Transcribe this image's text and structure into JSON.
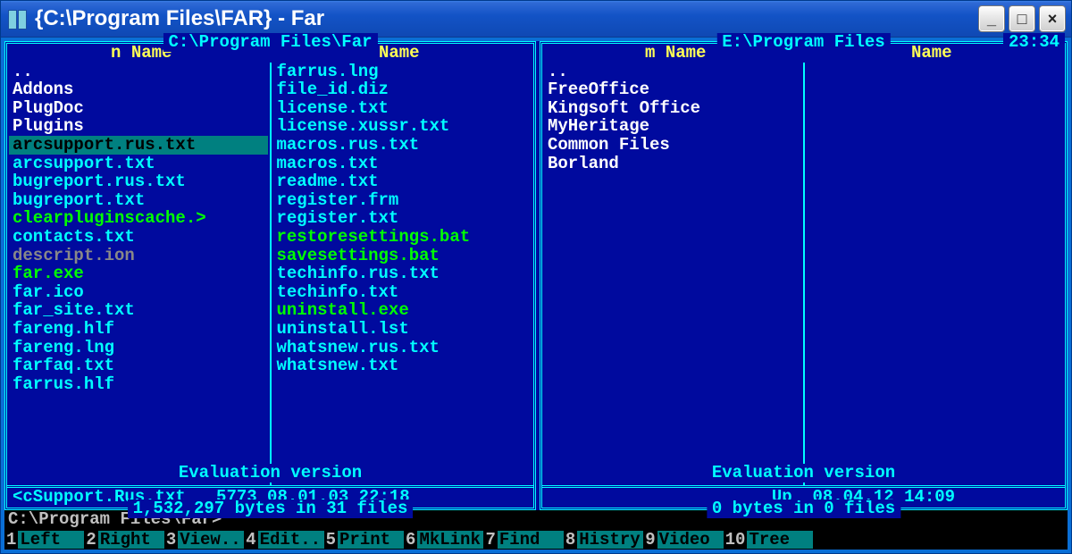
{
  "window": {
    "title": "{C:\\Program Files\\FAR} - Far",
    "buttons": {
      "min": "_",
      "max": "□",
      "close": "×"
    }
  },
  "clock": "23:34",
  "panels": {
    "left": {
      "path": " C:\\Program Files\\Far ",
      "col_heads": [
        "n       Name",
        "Name"
      ],
      "cols": [
        [
          {
            "text": "..",
            "cls": "clr-white"
          },
          {
            "text": "Addons",
            "cls": "clr-white"
          },
          {
            "text": "PlugDoc",
            "cls": "clr-white"
          },
          {
            "text": "Plugins",
            "cls": "clr-white"
          },
          {
            "text": "arcsupport.rus.txt",
            "cls": "sel"
          },
          {
            "text": "arcsupport.txt",
            "cls": "clr-cyan"
          },
          {
            "text": "bugreport.rus.txt",
            "cls": "clr-cyan"
          },
          {
            "text": "bugreport.txt",
            "cls": "clr-cyan"
          },
          {
            "text": "clearpluginscache.>",
            "cls": "clr-green"
          },
          {
            "text": "contacts.txt",
            "cls": "clr-cyan"
          },
          {
            "text": "descript.ion",
            "cls": "clr-gray"
          },
          {
            "text": "far.exe",
            "cls": "clr-green"
          },
          {
            "text": "far.ico",
            "cls": "clr-cyan"
          },
          {
            "text": "far_site.txt",
            "cls": "clr-cyan"
          },
          {
            "text": "fareng.hlf",
            "cls": "clr-cyan"
          },
          {
            "text": "fareng.lng",
            "cls": "clr-cyan"
          },
          {
            "text": "farfaq.txt",
            "cls": "clr-cyan"
          },
          {
            "text": "farrus.hlf",
            "cls": "clr-cyan"
          }
        ],
        [
          {
            "text": "farrus.lng",
            "cls": "clr-cyan"
          },
          {
            "text": "file_id.diz",
            "cls": "clr-cyan"
          },
          {
            "text": "license.txt",
            "cls": "clr-cyan"
          },
          {
            "text": "license.xussr.txt",
            "cls": "clr-cyan"
          },
          {
            "text": "macros.rus.txt",
            "cls": "clr-cyan"
          },
          {
            "text": "macros.txt",
            "cls": "clr-cyan"
          },
          {
            "text": "readme.txt",
            "cls": "clr-cyan"
          },
          {
            "text": "register.frm",
            "cls": "clr-cyan"
          },
          {
            "text": "register.txt",
            "cls": "clr-cyan"
          },
          {
            "text": "restoresettings.bat",
            "cls": "clr-green"
          },
          {
            "text": "savesettings.bat",
            "cls": "clr-green"
          },
          {
            "text": "techinfo.rus.txt",
            "cls": "clr-cyan"
          },
          {
            "text": "techinfo.txt",
            "cls": "clr-cyan"
          },
          {
            "text": "uninstall.exe",
            "cls": "clr-green"
          },
          {
            "text": "uninstall.lst",
            "cls": "clr-cyan"
          },
          {
            "text": "whatsnew.rus.txt",
            "cls": "clr-cyan"
          },
          {
            "text": "whatsnew.txt",
            "cls": "clr-cyan"
          }
        ]
      ],
      "eval_text": " Evaluation version ",
      "status": "<cSupport.Rus.txt   5773 08.01.03 22:18",
      "bytes": " 1,532,297 bytes in 31 files "
    },
    "right": {
      "path": " E:\\Program Files ",
      "col_heads": [
        "m       Name",
        "Name"
      ],
      "cols": [
        [
          {
            "text": "..",
            "cls": "clr-white"
          },
          {
            "text": "FreeOffice",
            "cls": "clr-white"
          },
          {
            "text": "Kingsoft Office",
            "cls": "clr-white"
          },
          {
            "text": "MyHeritage",
            "cls": "clr-white"
          },
          {
            "text": "Common Files",
            "cls": "clr-white"
          },
          {
            "text": "Borland",
            "cls": "clr-white"
          }
        ],
        []
      ],
      "eval_text": " Evaluation version ",
      "status": "                      Up  08.04.12 14:09",
      "bytes": " 0 bytes in 0 files "
    }
  },
  "prompt": "C:\\Program Files\\Far>",
  "fkeys": [
    {
      "n": "1",
      "label": "Left  "
    },
    {
      "n": "2",
      "label": "Right "
    },
    {
      "n": "3",
      "label": "View.."
    },
    {
      "n": "4",
      "label": "Edit.."
    },
    {
      "n": "5",
      "label": "Print "
    },
    {
      "n": "6",
      "label": "MkLink"
    },
    {
      "n": "7",
      "label": "Find  "
    },
    {
      "n": "8",
      "label": "Histry"
    },
    {
      "n": "9",
      "label": "Video "
    },
    {
      "n": "10",
      "label": "Tree  "
    }
  ]
}
